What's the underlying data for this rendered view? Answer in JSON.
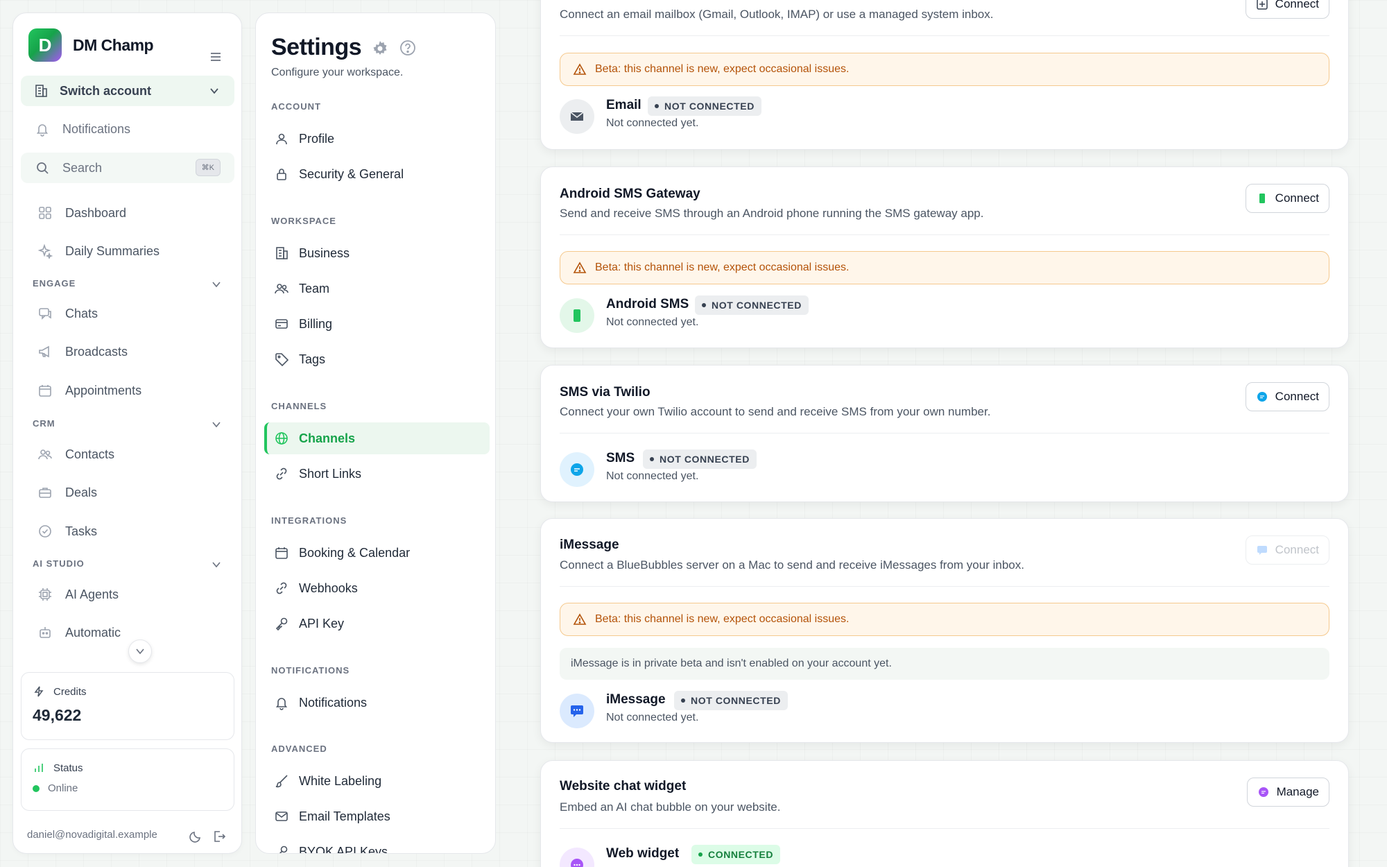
{
  "brand": {
    "name": "DM Champ",
    "logo_letter": "D"
  },
  "sidebar": {
    "switch_account": "Switch account",
    "notifications": "Notifications",
    "search_placeholder": "Search",
    "search_shortcut": "⌘K",
    "top_items": [
      {
        "label": "Dashboard",
        "icon": "grid-icon"
      },
      {
        "label": "Daily Summaries",
        "icon": "sparkles-icon"
      }
    ],
    "sections": [
      {
        "label": "ENGAGE",
        "items": [
          {
            "label": "Chats",
            "icon": "chat-icon"
          },
          {
            "label": "Broadcasts",
            "icon": "megaphone-icon"
          },
          {
            "label": "Appointments",
            "icon": "calendar-icon"
          }
        ]
      },
      {
        "label": "CRM",
        "items": [
          {
            "label": "Contacts",
            "icon": "users-icon"
          },
          {
            "label": "Deals",
            "icon": "briefcase-icon"
          },
          {
            "label": "Tasks",
            "icon": "check-circle-icon"
          }
        ]
      },
      {
        "label": "AI STUDIO",
        "items": [
          {
            "label": "AI Agents",
            "icon": "chip-icon"
          },
          {
            "label": "Automatic",
            "icon": "robot-icon"
          }
        ]
      }
    ],
    "credits": {
      "label": "Credits",
      "value": "49,622"
    },
    "status": {
      "label": "Status",
      "value": "Online",
      "color": "#22c55e"
    },
    "user_email": "daniel@novadigital.example"
  },
  "settings": {
    "title": "Settings",
    "subtitle": "Configure your workspace.",
    "sections": [
      {
        "label": "ACCOUNT",
        "items": [
          "Profile",
          "Security & General"
        ]
      },
      {
        "label": "WORKSPACE",
        "items": [
          "Business",
          "Team",
          "Billing",
          "Tags"
        ]
      },
      {
        "label": "CHANNELS",
        "items": [
          "Channels",
          "Short Links"
        ]
      },
      {
        "label": "INTEGRATIONS",
        "items": [
          "Booking & Calendar",
          "Webhooks",
          "API Key"
        ]
      },
      {
        "label": "NOTIFICATIONS",
        "items": [
          "Notifications"
        ]
      },
      {
        "label": "ADVANCED",
        "items": [
          "White Labeling",
          "Email Templates",
          "BYOK API Keys"
        ]
      }
    ],
    "active_item": "Channels"
  },
  "channels": {
    "beta_notice": "Beta: this channel is new, expect occasional issues.",
    "not_connected_badge": "NOT CONNECTED",
    "connected_badge": "CONNECTED",
    "not_connected_text": "Not connected yet.",
    "email": {
      "description": "Connect an email mailbox (Gmail, Outlook, IMAP) or use a managed system inbox.",
      "button": "Connect",
      "name": "Email"
    },
    "android": {
      "title": "Android SMS Gateway",
      "description": "Send and receive SMS through an Android phone running the SMS gateway app.",
      "button": "Connect",
      "name": "Android SMS"
    },
    "twilio": {
      "title": "SMS via Twilio",
      "description": "Connect your own Twilio account to send and receive SMS from your own number.",
      "button": "Connect",
      "name": "SMS"
    },
    "imessage": {
      "title": "iMessage",
      "description": "Connect a BlueBubbles server on a Mac to send and receive iMessages from your inbox.",
      "button": "Connect",
      "private_note": "iMessage is in private beta and isn't enabled on your account yet.",
      "name": "iMessage"
    },
    "widget": {
      "title": "Website chat widget",
      "description": "Embed an AI chat bubble on your website.",
      "button": "Manage",
      "name": "Web widget"
    }
  },
  "colors": {
    "accent": "#22c55e",
    "beta_text": "#b45309",
    "beta_bg": "#fff6ea"
  }
}
